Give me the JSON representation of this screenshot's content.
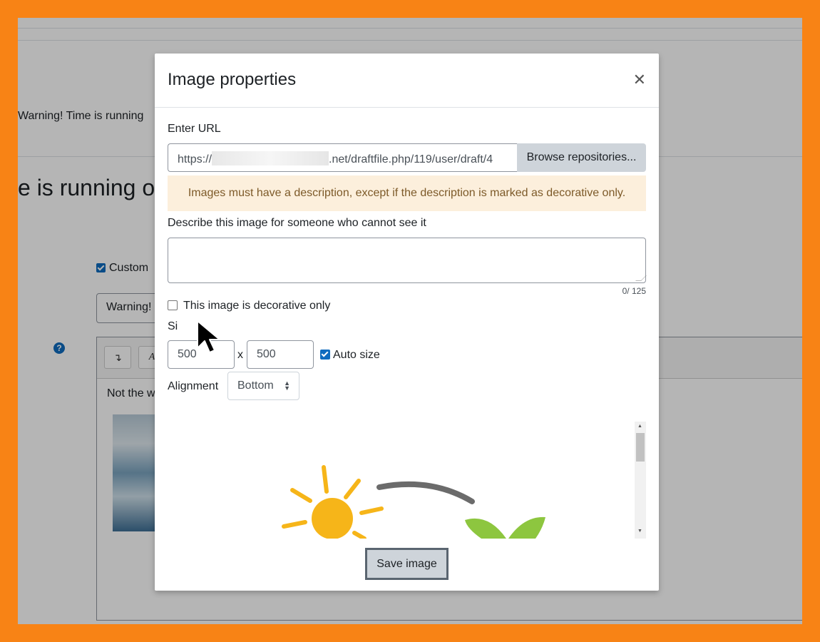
{
  "background_page": {
    "warning_snippet": "Warning! Time is running",
    "heading_snippet": "e is running ou",
    "custom_checkbox_label": "Custom",
    "warning_input_value": "Warning!",
    "help_icon": "question-circle-icon",
    "editor_text": "Not the w",
    "toolbar_icons": [
      "collapse-icon",
      "font-icon"
    ]
  },
  "modal": {
    "title": "Image properties",
    "close_icon": "close-icon",
    "url_label": "Enter URL",
    "url_prefix": "https://",
    "url_suffix": ".net/draftfile.php/119/user/draft/4",
    "browse_button": "Browse repositories...",
    "warning": "Images must have a description, except if the description is marked as decorative only.",
    "description_label": "Describe this image for someone who cannot see it",
    "description_value": "",
    "char_count": "0/ 125",
    "decorative_label": "This image is decorative only",
    "decorative_checked": false,
    "size_label": "Si",
    "width_value": "500",
    "height_value": "500",
    "size_separator": "x",
    "auto_size_label": "Auto size",
    "auto_size_checked": true,
    "alignment_label": "Alignment",
    "alignment_value": "Bottom",
    "save_button": "Save image"
  },
  "colors": {
    "frame": "#f88315",
    "primary": "#0f6cbf",
    "warning_bg": "#fcefdc",
    "warning_text": "#7d5a29",
    "button_bg": "#ced4da"
  }
}
